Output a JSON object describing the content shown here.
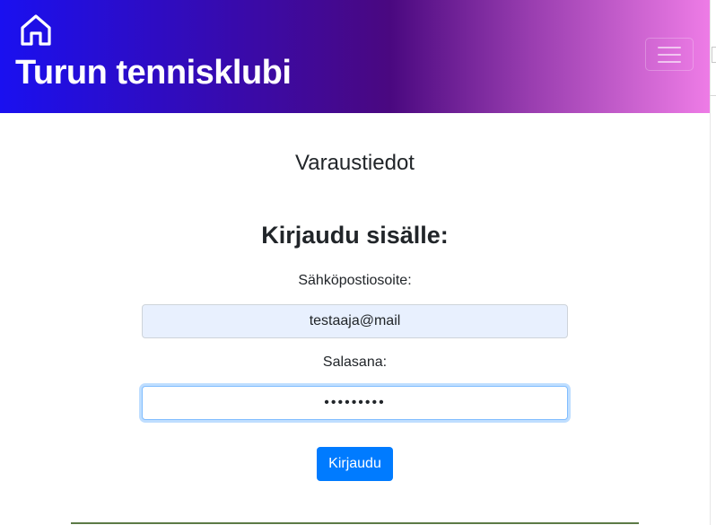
{
  "navbar": {
    "brand": "Turun tennisklubi",
    "home_icon": "home-icon",
    "toggler_icon": "hamburger-icon",
    "colors": {
      "gradient_start": "#1a10f0",
      "gradient_mid": "#4a0880",
      "gradient_end": "#ee7ce6"
    }
  },
  "main": {
    "page_title": "Varaustiedot",
    "login_title": "Kirjaudu sisälle:",
    "email_label": "Sähköpostiosoite:",
    "email_value": "testaaja@mail",
    "password_label": "Salasana:",
    "password_value": "testaaja1",
    "submit_label": "Kirjaudu"
  },
  "colors": {
    "primary": "#007bff",
    "autofill": "#e8f0fe",
    "divider": "#5b7a46"
  }
}
